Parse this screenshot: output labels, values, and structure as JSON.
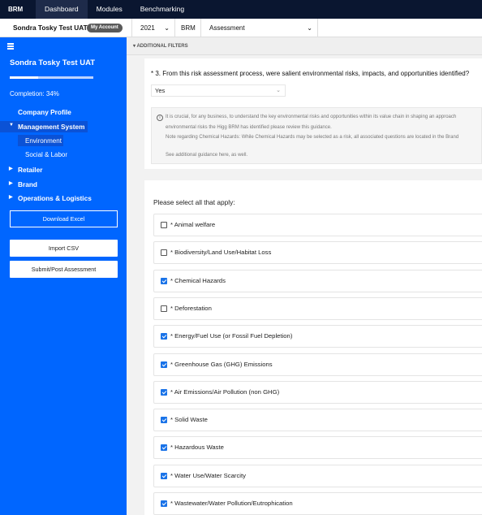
{
  "topnav": {
    "brand": "BRM",
    "items": [
      "Dashboard",
      "Modules",
      "Benchmarking"
    ]
  },
  "subheader": {
    "user": "Sondra Tosky Test UAT",
    "my_account": "My Account",
    "year": "2021",
    "module": "BRM",
    "assessment": "Assessment"
  },
  "sidebar": {
    "title": "Sondra Tosky Test UAT",
    "completion_label": "Completion: 34%",
    "completion": 0.34,
    "items": [
      "Company Profile",
      "Management System",
      "Environment",
      "Social & Labor",
      "Retailer",
      "Brand",
      "Operations & Logistics"
    ],
    "download": "Download Excel",
    "import": "Import CSV",
    "submit": "Submit/Post Assessment"
  },
  "filters_label": "▾ ADDITIONAL FILTERS",
  "question": {
    "text": "* 3. From this risk assessment process, were salient environmental risks, impacts, and opportunities identified?",
    "answer": "Yes",
    "guidance": [
      "It is crucial, for any business, to understand the key environmental risks and opportunities within its value chain in shaping an approach",
      "environmental risks the Higg BRM has identified please review this guidance.",
      "Note regarding Chemical Hazards: While Chemical Hazards may be selected as a risk, all associated questions are located in the Brand",
      "See additional guidance here, as well."
    ]
  },
  "select_instruction": "Please select all that apply:",
  "options": [
    {
      "label": "* Animal welfare",
      "checked": false
    },
    {
      "label": "* Biodiversity/Land Use/Habitat Loss",
      "checked": false
    },
    {
      "label": "* Chemical Hazards",
      "checked": true
    },
    {
      "label": "* Deforestation",
      "checked": false
    },
    {
      "label": "* Energy/Fuel Use (or Fossil Fuel Depletion)",
      "checked": true
    },
    {
      "label": "* Greenhouse Gas (GHG) Emissions",
      "checked": true
    },
    {
      "label": "* Air Emissions/Air Pollution (non GHG)",
      "checked": true
    },
    {
      "label": "* Solid Waste",
      "checked": true
    },
    {
      "label": "* Hazardous Waste",
      "checked": true
    },
    {
      "label": "* Water Use/Water Scarcity",
      "checked": true
    },
    {
      "label": "* Wastewater/Water Pollution/Eutrophication",
      "checked": true
    }
  ]
}
